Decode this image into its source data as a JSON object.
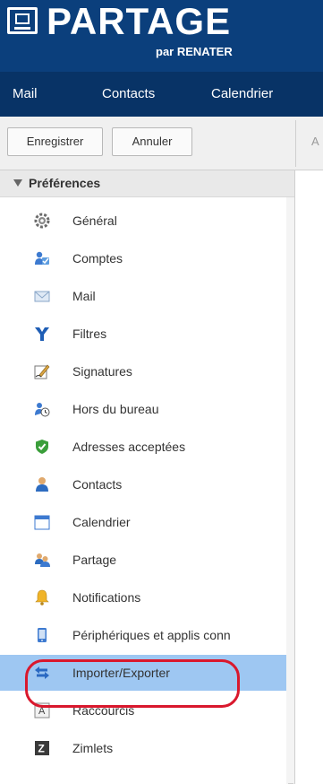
{
  "header": {
    "logo_text": "Partage",
    "logo_sub": "par RENATER"
  },
  "nav": {
    "items": [
      "Mail",
      "Contacts",
      "Calendrier"
    ]
  },
  "toolbar": {
    "save_label": "Enregistrer",
    "cancel_label": "Annuler",
    "right_partial": "A"
  },
  "sidebar": {
    "title": "Préférences",
    "selected_index": 13,
    "items": [
      {
        "label": "Général",
        "icon": "gear-icon"
      },
      {
        "label": "Comptes",
        "icon": "accounts-icon"
      },
      {
        "label": "Mail",
        "icon": "mail-icon"
      },
      {
        "label": "Filtres",
        "icon": "filter-icon"
      },
      {
        "label": "Signatures",
        "icon": "signature-icon"
      },
      {
        "label": "Hors du bureau",
        "icon": "out-of-office-icon"
      },
      {
        "label": "Adresses acceptées",
        "icon": "shield-check-icon"
      },
      {
        "label": "Contacts",
        "icon": "contact-icon"
      },
      {
        "label": "Calendrier",
        "icon": "calendar-icon"
      },
      {
        "label": "Partage",
        "icon": "sharing-icon"
      },
      {
        "label": "Notifications",
        "icon": "bell-icon"
      },
      {
        "label": "Périphériques et applis conn",
        "icon": "device-icon"
      },
      {
        "label": "Importer/Exporter",
        "icon": "import-export-icon"
      },
      {
        "label": "Raccourcis",
        "icon": "shortcuts-icon"
      },
      {
        "label": "Zimlets",
        "icon": "zimlet-icon"
      }
    ]
  },
  "colors": {
    "header_bg": "#0b3f7c",
    "nav_bg": "#083366",
    "selection": "#9ec7f2",
    "annotation": "#d9182d"
  }
}
